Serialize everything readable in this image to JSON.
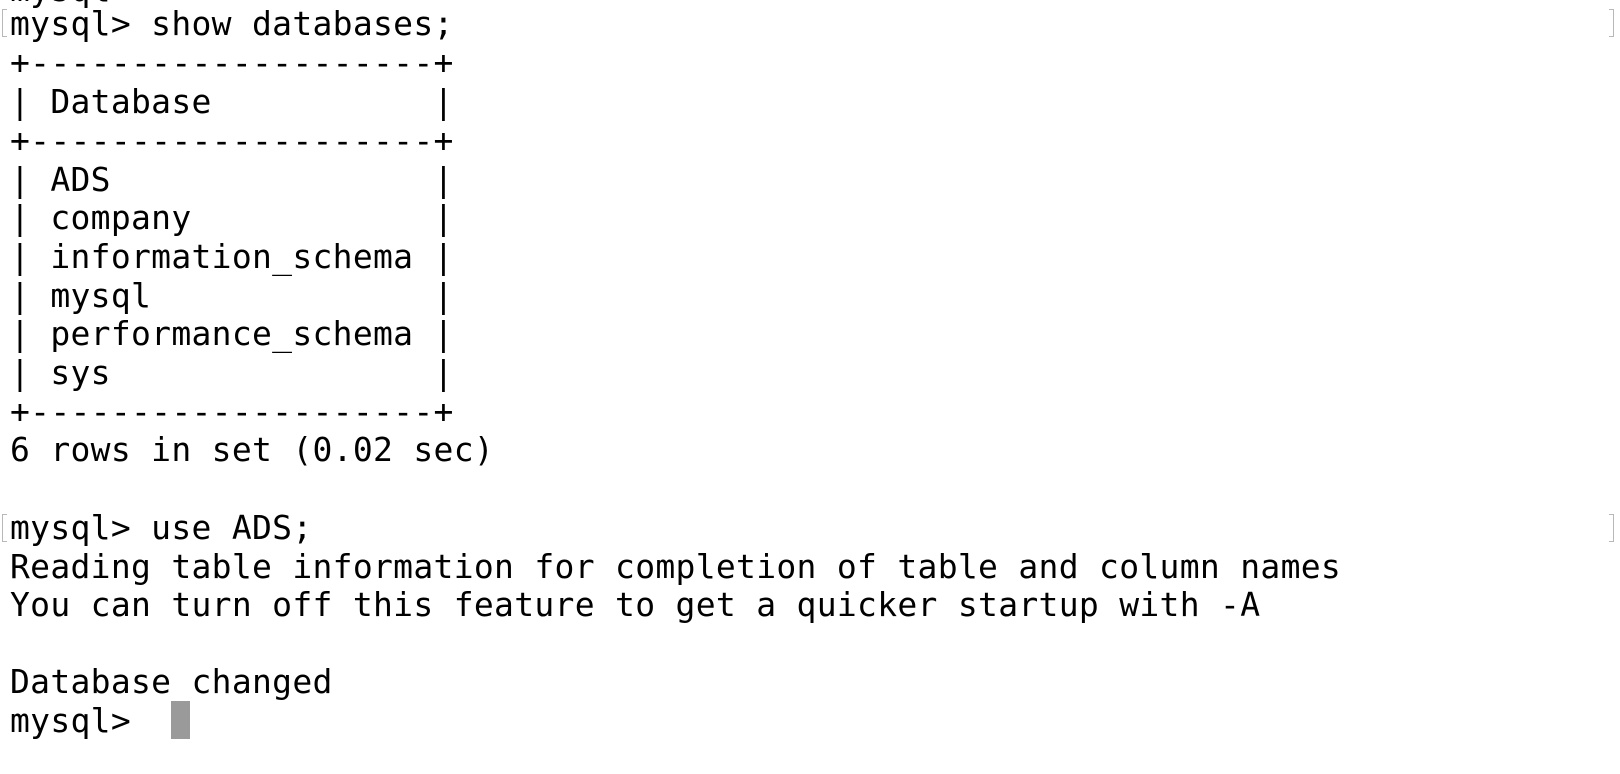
{
  "terminal": {
    "lines": [
      "mysql> show databases;",
      "+--------------------+",
      "| Database           |",
      "+--------------------+",
      "| ADS                |",
      "| company            |",
      "| information_schema |",
      "| mysql              |",
      "| performance_schema |",
      "| sys                |",
      "+--------------------+",
      "6 rows in set (0.02 sec)",
      "",
      "mysql> use ADS;",
      "Reading table information for completion of table and column names",
      "You can turn off this feature to get a quicker startup with -A",
      "",
      "Database changed",
      "mysql> "
    ],
    "top_fragment": "mysql>"
  }
}
